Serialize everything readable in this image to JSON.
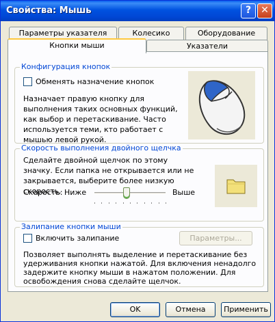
{
  "window": {
    "title": "Свойства: Мышь",
    "help_icon": "?",
    "close_icon": "✕"
  },
  "tabs": {
    "pointer_options": "Параметры указателя",
    "wheel": "Колесико",
    "hardware": "Оборудование",
    "buttons": "Кнопки мыши",
    "pointers": "Указатели"
  },
  "button_config": {
    "legend": "Конфигурация кнопок",
    "swap_checkbox": "Обменять назначение кнопок",
    "description": "Назначает правую кнопку для выполнения таких основных функций, как выбор и перетаскивание. Часто используется теми, кто работает с мышью левой рукой."
  },
  "double_click": {
    "legend": "Скорость выполнения двойного щелчка",
    "description": "Сделайте двойной щелчок по этому значку. Если папка не открывается или не закрывается, выберите более низкую скорость.",
    "speed_label": "Скорость:",
    "slow_label": "Ниже",
    "fast_label": "Выше",
    "speed_value": 0.45
  },
  "click_lock": {
    "legend": "Залипание кнопки мыши",
    "enable_checkbox": "Включить залипание",
    "settings_button": "Параметры...",
    "description": "Позволяет выполнять выделение и перетаскивание без удерживания кнопки нажатой. Для включения ненадолго задержите кнопку мыши в нажатом положении. Для освобождения снова сделайте щелчок."
  },
  "footer": {
    "ok": "OK",
    "cancel": "Отмена",
    "apply": "Применить"
  }
}
